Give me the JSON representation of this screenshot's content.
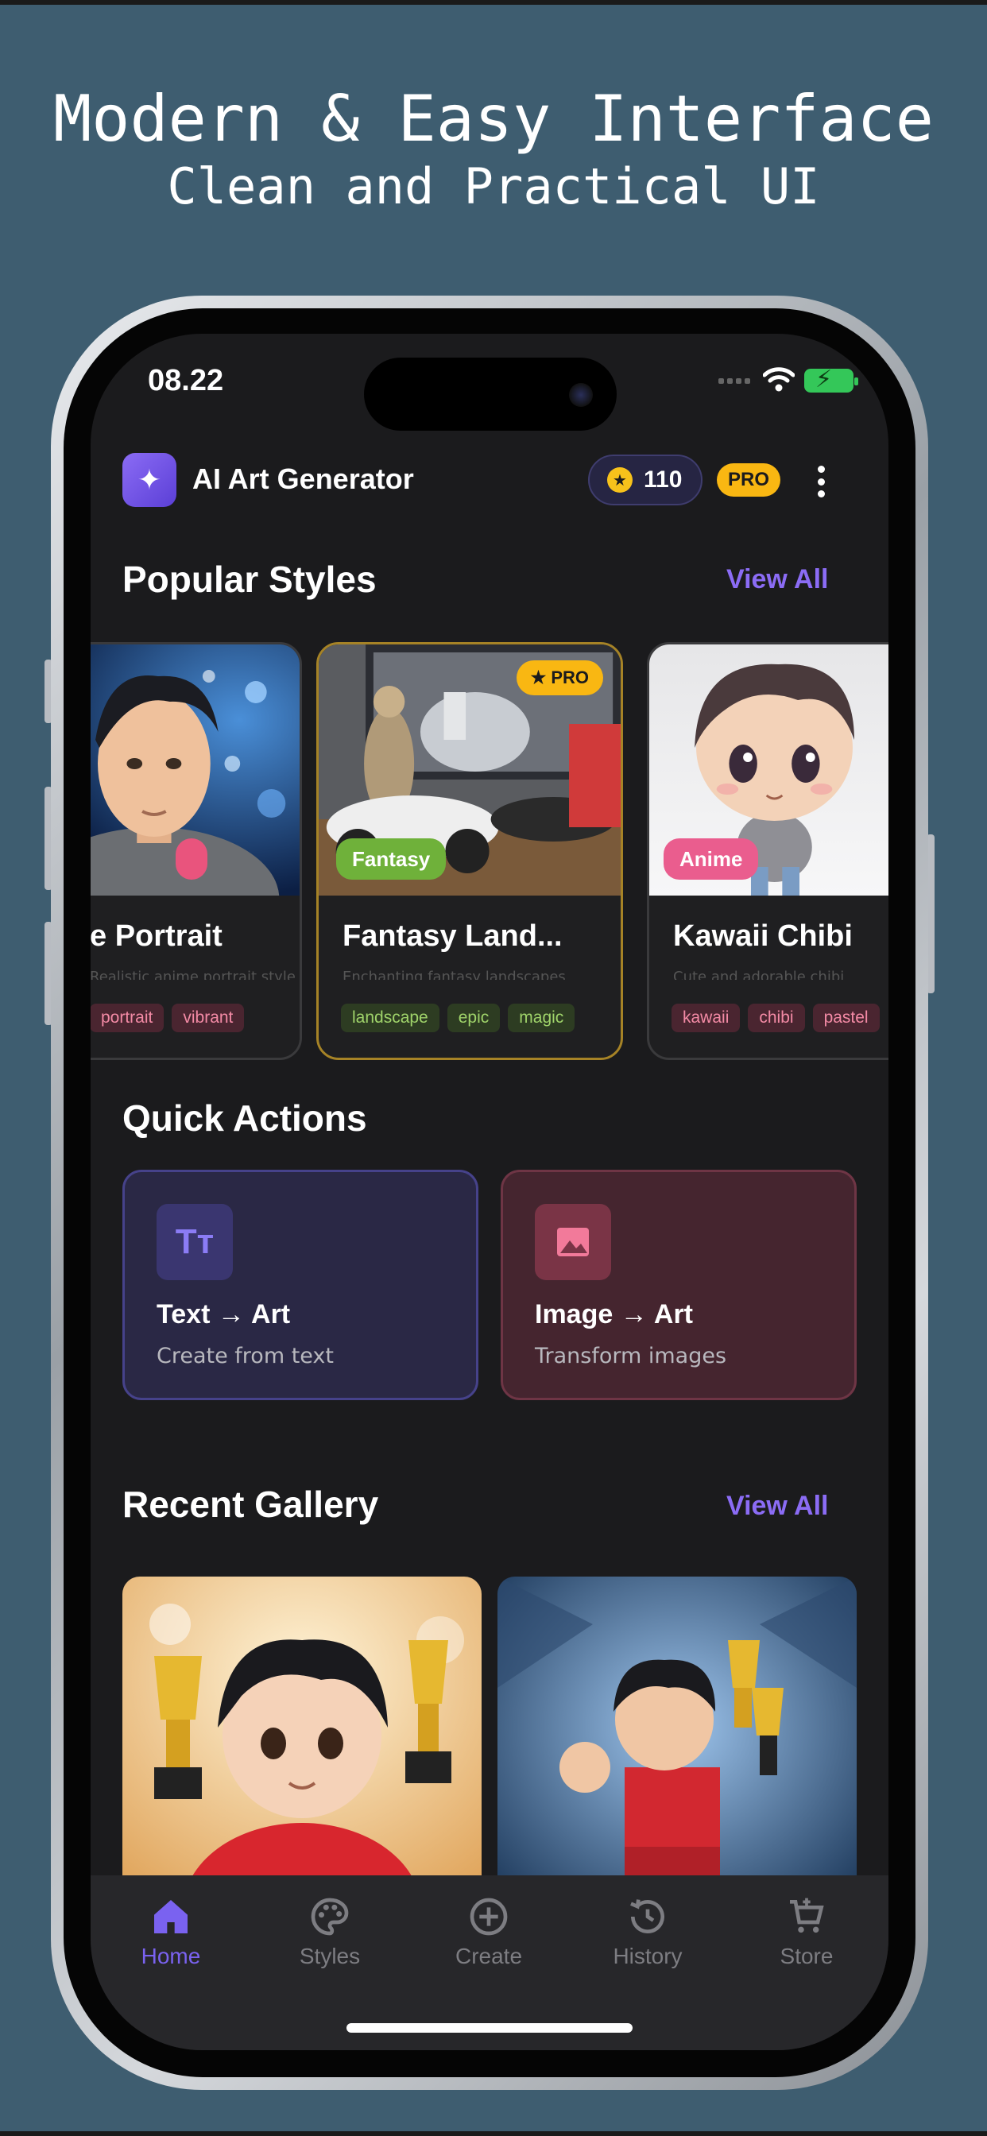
{
  "promo": {
    "headline": "Modern & Easy Interface",
    "subline": "Clean and Practical UI"
  },
  "status_bar": {
    "time": "08.22",
    "icons": [
      "signal-icon",
      "wifi-icon",
      "battery-charging-icon"
    ]
  },
  "app_bar": {
    "title": "AI Art Generator",
    "app_icon": "sparkles-icon",
    "coins": "110",
    "coin_icon": "star-coin-icon",
    "pro_label": "PRO",
    "menu_icon": "more-vertical-icon"
  },
  "popular_styles": {
    "title": "Popular Styles",
    "view_all": "View All",
    "cards": [
      {
        "title": "e Portrait",
        "description": "Realistic anime portrait style",
        "category": "",
        "tags": [
          "portrait",
          "vibrant"
        ]
      },
      {
        "title": "Fantasy Land...",
        "description": "Enchanting fantasy landscapes",
        "category": "Fantasy",
        "pro": "PRO",
        "tags": [
          "landscape",
          "epic",
          "magic"
        ]
      },
      {
        "title": "Kawaii Chibi",
        "description": "Cute and adorable chibi",
        "category": "Anime",
        "tags": [
          "kawaii",
          "chibi",
          "pastel"
        ]
      }
    ]
  },
  "quick_actions": {
    "title": "Quick Actions",
    "items": [
      {
        "title": "Text → Art",
        "subtitle": "Create from text",
        "icon": "text-format-icon"
      },
      {
        "title": "Image → Art",
        "subtitle": "Transform images",
        "icon": "image-icon"
      }
    ]
  },
  "recent_gallery": {
    "title": "Recent Gallery",
    "view_all": "View All"
  },
  "bottom_nav": {
    "items": [
      {
        "label": "Home",
        "icon": "home-icon",
        "active": true
      },
      {
        "label": "Styles",
        "icon": "palette-icon"
      },
      {
        "label": "Create",
        "icon": "add-circle-icon"
      },
      {
        "label": "History",
        "icon": "history-icon"
      },
      {
        "label": "Store",
        "icon": "cart-icon"
      }
    ]
  },
  "colors": {
    "background": "#3e5d70",
    "screen": "#1b1b1d",
    "accent": "#8b6cf5",
    "pro": "#f9b712"
  }
}
